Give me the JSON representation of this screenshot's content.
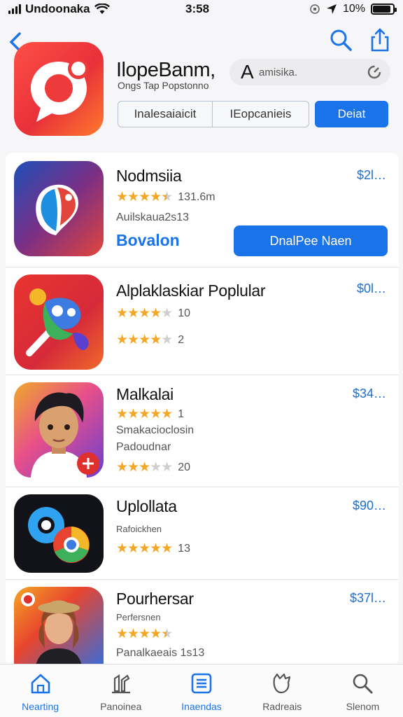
{
  "status_bar": {
    "carrier": "Undoonaka",
    "time": "3:58",
    "battery": "10%",
    "battery_level": 0.9
  },
  "header": {
    "title": "IlopeBanm,",
    "subtitle": "Ongs Tap Popstonno",
    "search_letter": "A",
    "search_text": "amisika.",
    "segments": [
      "Inalesaiaicit",
      "IEopcanieis"
    ],
    "detail_button": "Deiat"
  },
  "apps": [
    {
      "name": "Nodmsiia",
      "price": "$2l…",
      "stars": 4.5,
      "rating_text": "131.6m",
      "developer": "Auilskaua2s13",
      "link": "Bovalon",
      "button": "DnalPee Naen"
    },
    {
      "name": "Alplaklaskiar Poplular",
      "price": "$0l…",
      "lines": [
        {
          "stars": 4,
          "text": "10"
        },
        {
          "stars": 4,
          "text": "2"
        }
      ]
    },
    {
      "name": "Malkalai",
      "price": "$34…",
      "lines": [
        {
          "stars": 5,
          "text": "1"
        },
        {
          "text": "Smakacioclosin"
        },
        {
          "text": "Padoudnar"
        },
        {
          "stars": 3,
          "text": "20"
        }
      ]
    },
    {
      "name": "Uplollata",
      "price": "$90…",
      "lines": [
        {
          "text": "Rafoickhen"
        },
        {
          "stars": 5,
          "text": "13"
        }
      ]
    },
    {
      "name": "Pourhersar",
      "price": "$37l…",
      "lines": [
        {
          "text": "Perfersnen"
        },
        {
          "stars": 4.5,
          "text": ""
        },
        {
          "text": "Panalkaeais 1s13"
        }
      ]
    }
  ],
  "tabs": [
    {
      "label": "Nearting",
      "icon": "home-icon",
      "active": true
    },
    {
      "label": "Panoinea",
      "icon": "games-icon",
      "active": false
    },
    {
      "label": "Inaendas",
      "icon": "apps-icon",
      "active": true
    },
    {
      "label": "Radreais",
      "icon": "updates-icon",
      "active": false
    },
    {
      "label": "Slenom",
      "icon": "search-icon",
      "active": false
    }
  ],
  "colors": {
    "accent": "#1a73e8",
    "star": "#f5a623"
  }
}
